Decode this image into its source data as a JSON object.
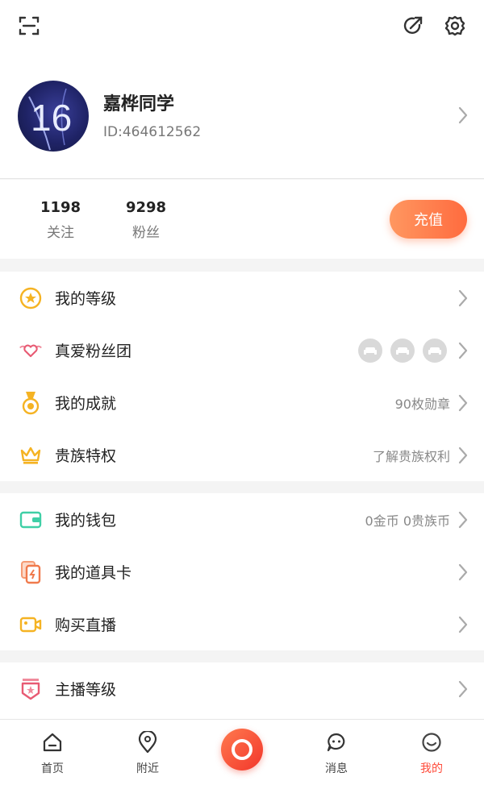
{
  "profile": {
    "name": "嘉桦同学",
    "id": "ID:464612562",
    "avatar_text": "16"
  },
  "stats": {
    "follow": {
      "count": "1198",
      "label": "关注"
    },
    "fans": {
      "count": "9298",
      "label": "粉丝"
    },
    "recharge_label": "充值"
  },
  "menu": {
    "level": "我的等级",
    "fan_club": "真爱粉丝团",
    "achievement": {
      "label": "我的成就",
      "value": "90枚勋章"
    },
    "privilege": {
      "label": "贵族特权",
      "value": "了解贵族权利"
    },
    "wallet": {
      "label": "我的钱包",
      "value": "0金币 0贵族币"
    },
    "prop_card": "我的道具卡",
    "buy_live": "购买直播",
    "anchor_level": "主播等级"
  },
  "tabs": {
    "home": "首页",
    "nearby": "附近",
    "messages": "消息",
    "mine": "我的"
  },
  "colors": {
    "accent": "#ff6b3f",
    "active_tab": "#ff4b3a"
  }
}
